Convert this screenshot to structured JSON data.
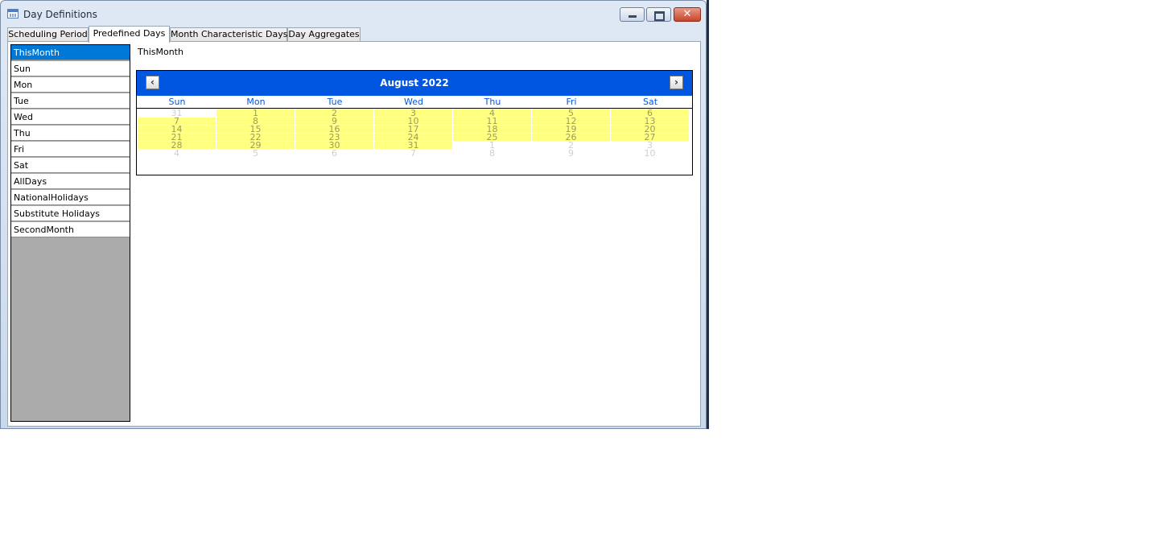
{
  "window": {
    "title": "Day Definitions"
  },
  "tabs": [
    {
      "label": "Scheduling Period"
    },
    {
      "label": "Predefined Days"
    },
    {
      "label": "Month Characteristic Days"
    },
    {
      "label": "Day Aggregates"
    }
  ],
  "active_tab": 1,
  "day_list": {
    "items": [
      "ThisMonth",
      "Sun",
      "Mon",
      "Tue",
      "Wed",
      "Thu",
      "Fri",
      "Sat",
      "AllDays",
      "NationalHolidays",
      "Substitute Holidays",
      "SecondMonth"
    ],
    "selected_index": 0
  },
  "selected_label": "ThisMonth",
  "calendar": {
    "month_title": "August 2022",
    "prev_glyph": "‹",
    "next_glyph": "›",
    "weekdays": [
      "Sun",
      "Mon",
      "Tue",
      "Wed",
      "Thu",
      "Fri",
      "Sat"
    ],
    "weeks": [
      [
        {
          "d": "31",
          "s": "other"
        },
        {
          "d": "1",
          "s": "hl"
        },
        {
          "d": "2",
          "s": "hl"
        },
        {
          "d": "3",
          "s": "hl"
        },
        {
          "d": "4",
          "s": "hl"
        },
        {
          "d": "5",
          "s": "hl"
        },
        {
          "d": "6",
          "s": "hl"
        }
      ],
      [
        {
          "d": "7",
          "s": "hl"
        },
        {
          "d": "8",
          "s": "hl"
        },
        {
          "d": "9",
          "s": "hl"
        },
        {
          "d": "10",
          "s": "hl"
        },
        {
          "d": "11",
          "s": "hl"
        },
        {
          "d": "12",
          "s": "hl"
        },
        {
          "d": "13",
          "s": "hl"
        }
      ],
      [
        {
          "d": "14",
          "s": "hl"
        },
        {
          "d": "15",
          "s": "hl"
        },
        {
          "d": "16",
          "s": "hl"
        },
        {
          "d": "17",
          "s": "hl"
        },
        {
          "d": "18",
          "s": "hl"
        },
        {
          "d": "19",
          "s": "hl"
        },
        {
          "d": "20",
          "s": "hl"
        }
      ],
      [
        {
          "d": "21",
          "s": "hl"
        },
        {
          "d": "22",
          "s": "hl"
        },
        {
          "d": "23",
          "s": "hl"
        },
        {
          "d": "24",
          "s": "hl"
        },
        {
          "d": "25",
          "s": "hl"
        },
        {
          "d": "26",
          "s": "hl"
        },
        {
          "d": "27",
          "s": "hl"
        }
      ],
      [
        {
          "d": "28",
          "s": "hl"
        },
        {
          "d": "29",
          "s": "hl"
        },
        {
          "d": "30",
          "s": "hl"
        },
        {
          "d": "31",
          "s": "hl"
        },
        {
          "d": "1",
          "s": "other"
        },
        {
          "d": "2",
          "s": "other"
        },
        {
          "d": "3",
          "s": "other"
        }
      ],
      [
        {
          "d": "4",
          "s": "other"
        },
        {
          "d": "5",
          "s": "other"
        },
        {
          "d": "6",
          "s": "other"
        },
        {
          "d": "7",
          "s": "other"
        },
        {
          "d": "8",
          "s": "other"
        },
        {
          "d": "9",
          "s": "other"
        },
        {
          "d": "10",
          "s": "other"
        }
      ]
    ]
  },
  "colors": {
    "calendar_header": "#0056e0",
    "highlight": "#ffff80",
    "selection": "#0078d7",
    "list_background": "#ababab"
  },
  "icons": {
    "app": "calendar-window-icon",
    "minimize": "minimize-icon",
    "maximize": "maximize-icon",
    "close": "close-icon"
  },
  "close_glyph": "✕"
}
